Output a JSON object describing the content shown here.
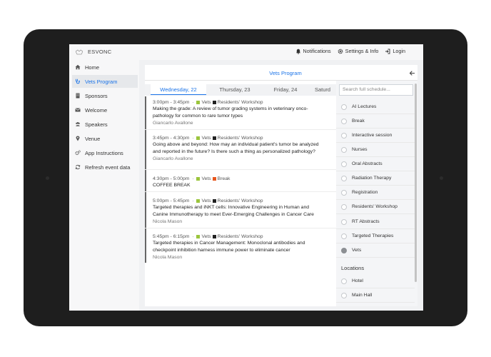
{
  "app": {
    "brand": "ESVONC",
    "top_nav": [
      {
        "label": "Notifications",
        "icon": "bell-icon"
      },
      {
        "label": "Settings & Info",
        "icon": "gear-icon"
      },
      {
        "label": "Login",
        "icon": "login-icon"
      }
    ]
  },
  "sidebar": {
    "items": [
      {
        "label": "Home",
        "icon": "home-icon",
        "active": false
      },
      {
        "label": "Vets Program",
        "icon": "stethoscope-icon",
        "active": true
      },
      {
        "label": "Sponsors",
        "icon": "building-icon",
        "active": false
      },
      {
        "label": "Welcome",
        "icon": "envelope-icon",
        "active": false
      },
      {
        "label": "Speakers",
        "icon": "users-icon",
        "active": false
      },
      {
        "label": "Venue",
        "icon": "map-pin-icon",
        "active": false
      },
      {
        "label": "App Instructions",
        "icon": "cogs-icon",
        "active": false
      },
      {
        "label": "Refresh event data",
        "icon": "refresh-icon",
        "active": false
      }
    ]
  },
  "panel": {
    "title": "Vets Program",
    "tabs": [
      {
        "label": "Wednesday, 22",
        "active": true
      },
      {
        "label": "Thursday, 23",
        "active": false
      },
      {
        "label": "Friday, 24",
        "active": false
      },
      {
        "label": "Saturd",
        "active": false
      }
    ]
  },
  "sessions": [
    {
      "time": "3:00pm - 3:45pm",
      "track": "Vets",
      "category": "Residents' Workshop",
      "category_color": "#222222",
      "title_lines": [
        "Making the grade: A review of tumor grading systems in veterinary onco-",
        "pathology for common to rare tumor types"
      ],
      "speaker": "Giancarlo Avallone"
    },
    {
      "time": "3:45pm - 4:30pm",
      "track": "Vets",
      "category": "Residents' Workshop",
      "category_color": "#222222",
      "title_lines": [
        "Going above and beyond: How may an individual patient's tumor be analyzed",
        "and reported in the future? Is there such a thing as personalized pathology?"
      ],
      "speaker": "Giancarlo Avallone"
    },
    {
      "time": "4:30pm - 5:00pm",
      "track": "Vets",
      "category": "Break",
      "category_color": "#e8571e",
      "title_lines": [
        "COFFEE BREAK"
      ],
      "speaker": ""
    },
    {
      "time": "5:00pm - 5:45pm",
      "track": "Vets",
      "category": "Residents' Workshop",
      "category_color": "#222222",
      "title_lines": [
        "Targeted therapies and iNKT cells: Innovative Engineering in Human and",
        "Canine Immunotherapy to meet Ever-Emerging Challenges in Cancer Care"
      ],
      "speaker": "Nicola Mason"
    },
    {
      "time": "5:45pm - 6:15pm",
      "track": "Vets",
      "category": "Residents' Workshop",
      "category_color": "#222222",
      "title_lines": [
        "Targeted therapies in Cancer Management: Monoclonal antibodies and",
        "checkpoint inhibition harness immune power to eliminate cancer"
      ],
      "speaker": "Nicola Mason"
    }
  ],
  "track_color": "#9bc53d",
  "filters": {
    "search_placeholder": "Search full schedule...",
    "tracks": [
      {
        "label": "AI Lectures",
        "checked": false
      },
      {
        "label": "Break",
        "checked": false
      },
      {
        "label": "Interactive session",
        "checked": false
      },
      {
        "label": "Nurses",
        "checked": false
      },
      {
        "label": "Oral Abstracts",
        "checked": false
      },
      {
        "label": "Radiation Therapy",
        "checked": false
      },
      {
        "label": "Registration",
        "checked": false
      },
      {
        "label": "Residents' Workshop",
        "checked": false
      },
      {
        "label": "RT Abstracts",
        "checked": false
      },
      {
        "label": "Targeted Therapies",
        "checked": false
      },
      {
        "label": "Vets",
        "checked": true
      }
    ],
    "locations_heading": "Locations",
    "locations": [
      {
        "label": "Hotel",
        "checked": false
      },
      {
        "label": "Main Hall",
        "checked": false
      }
    ]
  }
}
